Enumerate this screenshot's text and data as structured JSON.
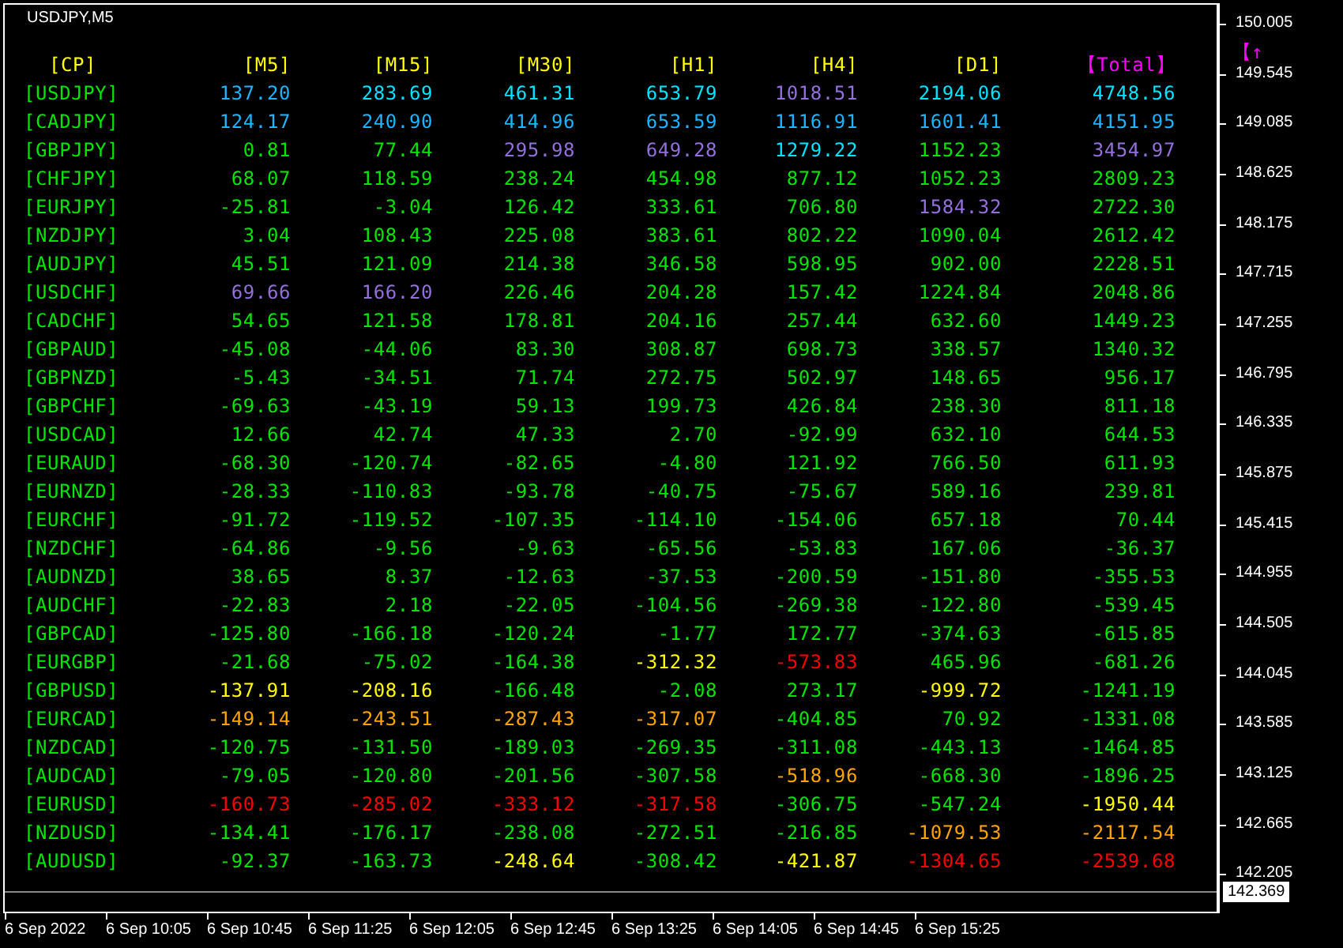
{
  "chart": {
    "title": "USDJPY,M5"
  },
  "table": {
    "columns": [
      {
        "label": "[CP]",
        "color": "#ffff00"
      },
      {
        "label": "[M5]",
        "color": "#ffff00"
      },
      {
        "label": "[M15]",
        "color": "#ffff00"
      },
      {
        "label": "[M30]",
        "color": "#ffff00"
      },
      {
        "label": "[H1]",
        "color": "#ffff00"
      },
      {
        "label": "[H4]",
        "color": "#ffff00"
      },
      {
        "label": "[D1]",
        "color": "#ffff00"
      },
      {
        "label": "【Total】",
        "color": "#ff00ff"
      },
      {
        "label": "【↑",
        "color": "#ff00ff"
      }
    ],
    "rows": [
      {
        "cells": [
          {
            "text": "[USDJPY]",
            "color": "#00e600"
          },
          {
            "text": "137.20",
            "color": "#1eb4ff"
          },
          {
            "text": "283.69",
            "color": "#00e5ff"
          },
          {
            "text": "461.31",
            "color": "#00e5ff"
          },
          {
            "text": "653.79",
            "color": "#00e5ff"
          },
          {
            "text": "1018.51",
            "color": "#9370db"
          },
          {
            "text": "2194.06",
            "color": "#00e5ff"
          },
          {
            "text": "4748.56",
            "color": "#00e5ff"
          }
        ]
      },
      {
        "cells": [
          {
            "text": "[CADJPY]",
            "color": "#00e600"
          },
          {
            "text": "124.17",
            "color": "#1eb4ff"
          },
          {
            "text": "240.90",
            "color": "#1eb4ff"
          },
          {
            "text": "414.96",
            "color": "#1eb4ff"
          },
          {
            "text": "653.59",
            "color": "#1eb4ff"
          },
          {
            "text": "1116.91",
            "color": "#1eb4ff"
          },
          {
            "text": "1601.41",
            "color": "#1eb4ff"
          },
          {
            "text": "4151.95",
            "color": "#1eb4ff"
          }
        ]
      },
      {
        "cells": [
          {
            "text": "[GBPJPY]",
            "color": "#00e600"
          },
          {
            "text": "0.81",
            "color": "#00e600"
          },
          {
            "text": "77.44",
            "color": "#00e600"
          },
          {
            "text": "295.98",
            "color": "#9370db"
          },
          {
            "text": "649.28",
            "color": "#9370db"
          },
          {
            "text": "1279.22",
            "color": "#00e5ff"
          },
          {
            "text": "1152.23",
            "color": "#00e600"
          },
          {
            "text": "3454.97",
            "color": "#9370db"
          }
        ]
      },
      {
        "cells": [
          {
            "text": "[CHFJPY]",
            "color": "#00e600"
          },
          {
            "text": "68.07",
            "color": "#00e600"
          },
          {
            "text": "118.59",
            "color": "#00e600"
          },
          {
            "text": "238.24",
            "color": "#00e600"
          },
          {
            "text": "454.98",
            "color": "#00e600"
          },
          {
            "text": "877.12",
            "color": "#00e600"
          },
          {
            "text": "1052.23",
            "color": "#00e600"
          },
          {
            "text": "2809.23",
            "color": "#00e600"
          }
        ]
      },
      {
        "cells": [
          {
            "text": "[EURJPY]",
            "color": "#00e600"
          },
          {
            "text": "-25.81",
            "color": "#00e600"
          },
          {
            "text": "-3.04",
            "color": "#00e600"
          },
          {
            "text": "126.42",
            "color": "#00e600"
          },
          {
            "text": "333.61",
            "color": "#00e600"
          },
          {
            "text": "706.80",
            "color": "#00e600"
          },
          {
            "text": "1584.32",
            "color": "#9370db"
          },
          {
            "text": "2722.30",
            "color": "#00e600"
          }
        ]
      },
      {
        "cells": [
          {
            "text": "[NZDJPY]",
            "color": "#00e600"
          },
          {
            "text": "3.04",
            "color": "#00e600"
          },
          {
            "text": "108.43",
            "color": "#00e600"
          },
          {
            "text": "225.08",
            "color": "#00e600"
          },
          {
            "text": "383.61",
            "color": "#00e600"
          },
          {
            "text": "802.22",
            "color": "#00e600"
          },
          {
            "text": "1090.04",
            "color": "#00e600"
          },
          {
            "text": "2612.42",
            "color": "#00e600"
          }
        ]
      },
      {
        "cells": [
          {
            "text": "[AUDJPY]",
            "color": "#00e600"
          },
          {
            "text": "45.51",
            "color": "#00e600"
          },
          {
            "text": "121.09",
            "color": "#00e600"
          },
          {
            "text": "214.38",
            "color": "#00e600"
          },
          {
            "text": "346.58",
            "color": "#00e600"
          },
          {
            "text": "598.95",
            "color": "#00e600"
          },
          {
            "text": "902.00",
            "color": "#00e600"
          },
          {
            "text": "2228.51",
            "color": "#00e600"
          }
        ]
      },
      {
        "cells": [
          {
            "text": "[USDCHF]",
            "color": "#00e600"
          },
          {
            "text": "69.66",
            "color": "#9370db"
          },
          {
            "text": "166.20",
            "color": "#9370db"
          },
          {
            "text": "226.46",
            "color": "#00e600"
          },
          {
            "text": "204.28",
            "color": "#00e600"
          },
          {
            "text": "157.42",
            "color": "#00e600"
          },
          {
            "text": "1224.84",
            "color": "#00e600"
          },
          {
            "text": "2048.86",
            "color": "#00e600"
          }
        ]
      },
      {
        "cells": [
          {
            "text": "[CADCHF]",
            "color": "#00e600"
          },
          {
            "text": "54.65",
            "color": "#00e600"
          },
          {
            "text": "121.58",
            "color": "#00e600"
          },
          {
            "text": "178.81",
            "color": "#00e600"
          },
          {
            "text": "204.16",
            "color": "#00e600"
          },
          {
            "text": "257.44",
            "color": "#00e600"
          },
          {
            "text": "632.60",
            "color": "#00e600"
          },
          {
            "text": "1449.23",
            "color": "#00e600"
          }
        ]
      },
      {
        "cells": [
          {
            "text": "[GBPAUD]",
            "color": "#00e600"
          },
          {
            "text": "-45.08",
            "color": "#00e600"
          },
          {
            "text": "-44.06",
            "color": "#00e600"
          },
          {
            "text": "83.30",
            "color": "#00e600"
          },
          {
            "text": "308.87",
            "color": "#00e600"
          },
          {
            "text": "698.73",
            "color": "#00e600"
          },
          {
            "text": "338.57",
            "color": "#00e600"
          },
          {
            "text": "1340.32",
            "color": "#00e600"
          }
        ]
      },
      {
        "cells": [
          {
            "text": "[GBPNZD]",
            "color": "#00e600"
          },
          {
            "text": "-5.43",
            "color": "#00e600"
          },
          {
            "text": "-34.51",
            "color": "#00e600"
          },
          {
            "text": "71.74",
            "color": "#00e600"
          },
          {
            "text": "272.75",
            "color": "#00e600"
          },
          {
            "text": "502.97",
            "color": "#00e600"
          },
          {
            "text": "148.65",
            "color": "#00e600"
          },
          {
            "text": "956.17",
            "color": "#00e600"
          }
        ]
      },
      {
        "cells": [
          {
            "text": "[GBPCHF]",
            "color": "#00e600"
          },
          {
            "text": "-69.63",
            "color": "#00e600"
          },
          {
            "text": "-43.19",
            "color": "#00e600"
          },
          {
            "text": "59.13",
            "color": "#00e600"
          },
          {
            "text": "199.73",
            "color": "#00e600"
          },
          {
            "text": "426.84",
            "color": "#00e600"
          },
          {
            "text": "238.30",
            "color": "#00e600"
          },
          {
            "text": "811.18",
            "color": "#00e600"
          }
        ]
      },
      {
        "cells": [
          {
            "text": "[USDCAD]",
            "color": "#00e600"
          },
          {
            "text": "12.66",
            "color": "#00e600"
          },
          {
            "text": "42.74",
            "color": "#00e600"
          },
          {
            "text": "47.33",
            "color": "#00e600"
          },
          {
            "text": "2.70",
            "color": "#00e600"
          },
          {
            "text": "-92.99",
            "color": "#00e600"
          },
          {
            "text": "632.10",
            "color": "#00e600"
          },
          {
            "text": "644.53",
            "color": "#00e600"
          }
        ]
      },
      {
        "cells": [
          {
            "text": "[EURAUD]",
            "color": "#00e600"
          },
          {
            "text": "-68.30",
            "color": "#00e600"
          },
          {
            "text": "-120.74",
            "color": "#00e600"
          },
          {
            "text": "-82.65",
            "color": "#00e600"
          },
          {
            "text": "-4.80",
            "color": "#00e600"
          },
          {
            "text": "121.92",
            "color": "#00e600"
          },
          {
            "text": "766.50",
            "color": "#00e600"
          },
          {
            "text": "611.93",
            "color": "#00e600"
          }
        ]
      },
      {
        "cells": [
          {
            "text": "[EURNZD]",
            "color": "#00e600"
          },
          {
            "text": "-28.33",
            "color": "#00e600"
          },
          {
            "text": "-110.83",
            "color": "#00e600"
          },
          {
            "text": "-93.78",
            "color": "#00e600"
          },
          {
            "text": "-40.75",
            "color": "#00e600"
          },
          {
            "text": "-75.67",
            "color": "#00e600"
          },
          {
            "text": "589.16",
            "color": "#00e600"
          },
          {
            "text": "239.81",
            "color": "#00e600"
          }
        ]
      },
      {
        "cells": [
          {
            "text": "[EURCHF]",
            "color": "#00e600"
          },
          {
            "text": "-91.72",
            "color": "#00e600"
          },
          {
            "text": "-119.52",
            "color": "#00e600"
          },
          {
            "text": "-107.35",
            "color": "#00e600"
          },
          {
            "text": "-114.10",
            "color": "#00e600"
          },
          {
            "text": "-154.06",
            "color": "#00e600"
          },
          {
            "text": "657.18",
            "color": "#00e600"
          },
          {
            "text": "70.44",
            "color": "#00e600"
          }
        ]
      },
      {
        "cells": [
          {
            "text": "[NZDCHF]",
            "color": "#00e600"
          },
          {
            "text": "-64.86",
            "color": "#00e600"
          },
          {
            "text": "-9.56",
            "color": "#00e600"
          },
          {
            "text": "-9.63",
            "color": "#00e600"
          },
          {
            "text": "-65.56",
            "color": "#00e600"
          },
          {
            "text": "-53.83",
            "color": "#00e600"
          },
          {
            "text": "167.06",
            "color": "#00e600"
          },
          {
            "text": "-36.37",
            "color": "#00e600"
          }
        ]
      },
      {
        "cells": [
          {
            "text": "[AUDNZD]",
            "color": "#00e600"
          },
          {
            "text": "38.65",
            "color": "#00e600"
          },
          {
            "text": "8.37",
            "color": "#00e600"
          },
          {
            "text": "-12.63",
            "color": "#00e600"
          },
          {
            "text": "-37.53",
            "color": "#00e600"
          },
          {
            "text": "-200.59",
            "color": "#00e600"
          },
          {
            "text": "-151.80",
            "color": "#00e600"
          },
          {
            "text": "-355.53",
            "color": "#00e600"
          }
        ]
      },
      {
        "cells": [
          {
            "text": "[AUDCHF]",
            "color": "#00e600"
          },
          {
            "text": "-22.83",
            "color": "#00e600"
          },
          {
            "text": "2.18",
            "color": "#00e600"
          },
          {
            "text": "-22.05",
            "color": "#00e600"
          },
          {
            "text": "-104.56",
            "color": "#00e600"
          },
          {
            "text": "-269.38",
            "color": "#00e600"
          },
          {
            "text": "-122.80",
            "color": "#00e600"
          },
          {
            "text": "-539.45",
            "color": "#00e600"
          }
        ]
      },
      {
        "cells": [
          {
            "text": "[GBPCAD]",
            "color": "#00e600"
          },
          {
            "text": "-125.80",
            "color": "#00e600"
          },
          {
            "text": "-166.18",
            "color": "#00e600"
          },
          {
            "text": "-120.24",
            "color": "#00e600"
          },
          {
            "text": "-1.77",
            "color": "#00e600"
          },
          {
            "text": "172.77",
            "color": "#00e600"
          },
          {
            "text": "-374.63",
            "color": "#00e600"
          },
          {
            "text": "-615.85",
            "color": "#00e600"
          }
        ]
      },
      {
        "cells": [
          {
            "text": "[EURGBP]",
            "color": "#00e600"
          },
          {
            "text": "-21.68",
            "color": "#00e600"
          },
          {
            "text": "-75.02",
            "color": "#00e600"
          },
          {
            "text": "-164.38",
            "color": "#00e600"
          },
          {
            "text": "-312.32",
            "color": "#ffff00"
          },
          {
            "text": "-573.83",
            "color": "#ff0000"
          },
          {
            "text": "465.96",
            "color": "#00e600"
          },
          {
            "text": "-681.26",
            "color": "#00e600"
          }
        ]
      },
      {
        "cells": [
          {
            "text": "[GBPUSD]",
            "color": "#00e600"
          },
          {
            "text": "-137.91",
            "color": "#ffff00"
          },
          {
            "text": "-208.16",
            "color": "#ffff00"
          },
          {
            "text": "-166.48",
            "color": "#00e600"
          },
          {
            "text": "-2.08",
            "color": "#00e600"
          },
          {
            "text": "273.17",
            "color": "#00e600"
          },
          {
            "text": "-999.72",
            "color": "#ffff00"
          },
          {
            "text": "-1241.19",
            "color": "#00e600"
          }
        ]
      },
      {
        "cells": [
          {
            "text": "[EURCAD]",
            "color": "#00e600"
          },
          {
            "text": "-149.14",
            "color": "#ffa500"
          },
          {
            "text": "-243.51",
            "color": "#ffa500"
          },
          {
            "text": "-287.43",
            "color": "#ffa500"
          },
          {
            "text": "-317.07",
            "color": "#ffa500"
          },
          {
            "text": "-404.85",
            "color": "#00e600"
          },
          {
            "text": "70.92",
            "color": "#00e600"
          },
          {
            "text": "-1331.08",
            "color": "#00e600"
          }
        ]
      },
      {
        "cells": [
          {
            "text": "[NZDCAD]",
            "color": "#00e600"
          },
          {
            "text": "-120.75",
            "color": "#00e600"
          },
          {
            "text": "-131.50",
            "color": "#00e600"
          },
          {
            "text": "-189.03",
            "color": "#00e600"
          },
          {
            "text": "-269.35",
            "color": "#00e600"
          },
          {
            "text": "-311.08",
            "color": "#00e600"
          },
          {
            "text": "-443.13",
            "color": "#00e600"
          },
          {
            "text": "-1464.85",
            "color": "#00e600"
          }
        ]
      },
      {
        "cells": [
          {
            "text": "[AUDCAD]",
            "color": "#00e600"
          },
          {
            "text": "-79.05",
            "color": "#00e600"
          },
          {
            "text": "-120.80",
            "color": "#00e600"
          },
          {
            "text": "-201.56",
            "color": "#00e600"
          },
          {
            "text": "-307.58",
            "color": "#00e600"
          },
          {
            "text": "-518.96",
            "color": "#ffa500"
          },
          {
            "text": "-668.30",
            "color": "#00e600"
          },
          {
            "text": "-1896.25",
            "color": "#00e600"
          }
        ]
      },
      {
        "cells": [
          {
            "text": "[EURUSD]",
            "color": "#00e600"
          },
          {
            "text": "-160.73",
            "color": "#ff0000"
          },
          {
            "text": "-285.02",
            "color": "#ff0000"
          },
          {
            "text": "-333.12",
            "color": "#ff0000"
          },
          {
            "text": "-317.58",
            "color": "#ff0000"
          },
          {
            "text": "-306.75",
            "color": "#00e600"
          },
          {
            "text": "-547.24",
            "color": "#00e600"
          },
          {
            "text": "-1950.44",
            "color": "#ffff00"
          }
        ]
      },
      {
        "cells": [
          {
            "text": "[NZDUSD]",
            "color": "#00e600"
          },
          {
            "text": "-134.41",
            "color": "#00e600"
          },
          {
            "text": "-176.17",
            "color": "#00e600"
          },
          {
            "text": "-238.08",
            "color": "#00e600"
          },
          {
            "text": "-272.51",
            "color": "#00e600"
          },
          {
            "text": "-216.85",
            "color": "#00e600"
          },
          {
            "text": "-1079.53",
            "color": "#ffa500"
          },
          {
            "text": "-2117.54",
            "color": "#ffa500"
          }
        ]
      },
      {
        "cells": [
          {
            "text": "[AUDUSD]",
            "color": "#00e600"
          },
          {
            "text": "-92.37",
            "color": "#00e600"
          },
          {
            "text": "-163.73",
            "color": "#00e600"
          },
          {
            "text": "-248.64",
            "color": "#ffff00"
          },
          {
            "text": "-308.42",
            "color": "#00e600"
          },
          {
            "text": "-421.87",
            "color": "#ffff00"
          },
          {
            "text": "-1304.65",
            "color": "#ff0000"
          },
          {
            "text": "-2539.68",
            "color": "#ff0000"
          }
        ]
      }
    ]
  },
  "price_axis": {
    "labels": [
      "150.005",
      "149.545",
      "149.085",
      "148.625",
      "148.175",
      "147.715",
      "147.255",
      "146.795",
      "146.335",
      "145.875",
      "145.415",
      "144.955",
      "144.505",
      "144.045",
      "143.585",
      "143.125",
      "142.665",
      "142.205"
    ],
    "current_price": "142.369"
  },
  "time_axis": {
    "labels": [
      "6 Sep 2022",
      "6 Sep 10:05",
      "6 Sep 10:45",
      "6 Sep 11:25",
      "6 Sep 12:05",
      "6 Sep 12:45",
      "6 Sep 13:25",
      "6 Sep 14:05",
      "6 Sep 14:45",
      "6 Sep 15:25"
    ]
  }
}
